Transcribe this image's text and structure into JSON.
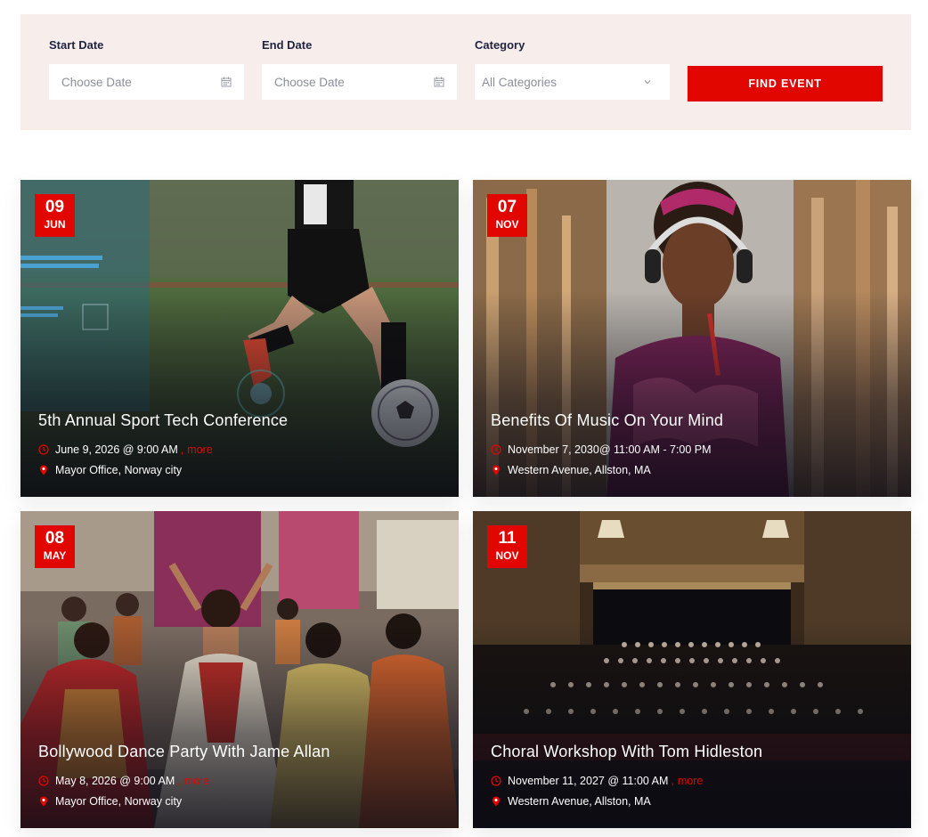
{
  "filter": {
    "start_label": "Start Date",
    "start_placeholder": "Choose Date",
    "end_label": "End Date",
    "end_placeholder": "Choose Date",
    "category_label": "Category",
    "category_selected": "All Categories",
    "find_button": "FIND EVENT"
  },
  "colors": {
    "accent": "#e10600",
    "filter_bg": "#f7eeec"
  },
  "events": [
    {
      "day": "09",
      "month": "JUN",
      "title": "5th Annual Sport Tech Conference",
      "time": "June 9, 2026 @ 9:00 AM",
      "more": "more",
      "location": "Mayor Office, Norway city"
    },
    {
      "day": "07",
      "month": "NOV",
      "title": "Benefits Of Music On Your Mind",
      "time": "November 7, 2030@ 11:00 AM - 7:00 PM",
      "more": "",
      "location": "Western Avenue, Allston, MA"
    },
    {
      "day": "08",
      "month": "MAY",
      "title": "Bollywood Dance Party With Jame Allan",
      "time": "May 8, 2026 @ 9:00 AM",
      "more": "more",
      "location": "Mayor Office, Norway city"
    },
    {
      "day": "11",
      "month": "NOV",
      "title": "Choral Workshop With Tom Hidleston",
      "time": "November 11, 2027 @ 11:00 AM",
      "more": "more",
      "location": "Western Avenue, Allston, MA"
    }
  ]
}
